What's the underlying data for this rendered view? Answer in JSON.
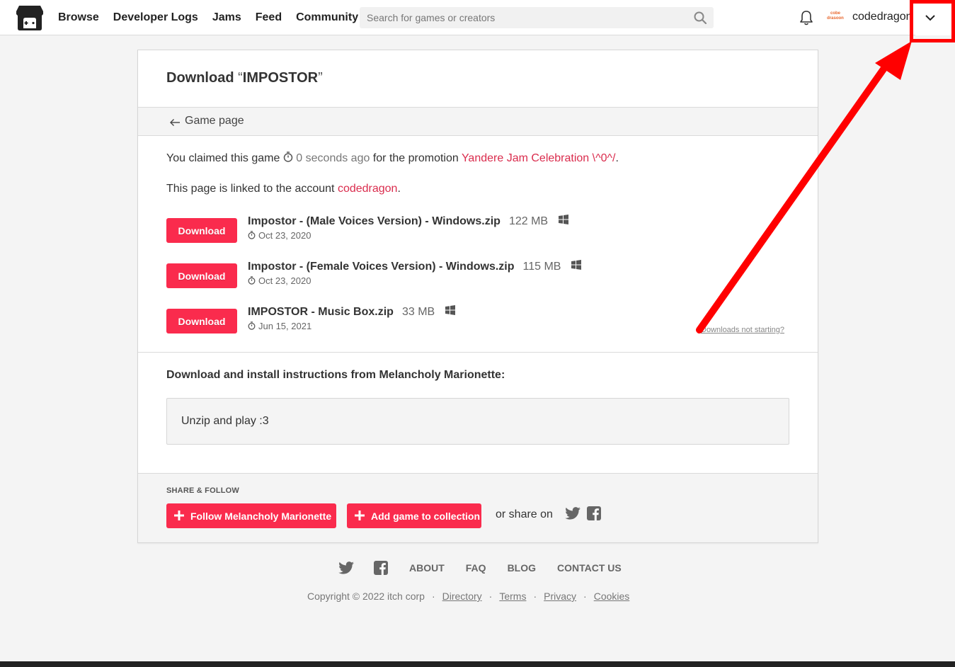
{
  "nav": {
    "items": [
      "Browse",
      "Developer Logs",
      "Jams",
      "Feed",
      "Community"
    ],
    "search_placeholder": "Search for games or creators",
    "username": "codedragon",
    "avatar_text": "cobe\ndrasoon"
  },
  "page": {
    "title_prefix": "Download ",
    "open_quote": "“",
    "game_name": "IMPOSTOR",
    "close_quote": "”",
    "game_page_link": "Game page",
    "claim_text": "You claimed this game",
    "claim_time": "0 seconds ago",
    "claim_for": "for the promotion",
    "promotion": "Yandere Jam Celebration \\^0^/",
    "claim_end": ".",
    "linked_text": "This page is linked to the account",
    "linked_account": "codedragon",
    "linked_end": "."
  },
  "downloads": [
    {
      "button": "Download",
      "name": "Impostor - (Male Voices Version) - Windows.zip",
      "size": "122 MB",
      "platform": "windows-icon",
      "date": "Oct 23, 2020"
    },
    {
      "button": "Download",
      "name": "Impostor - (Female Voices Version) - Windows.zip",
      "size": "115 MB",
      "platform": "windows-icon",
      "date": "Oct 23, 2020"
    },
    {
      "button": "Download",
      "name": "IMPOSTOR - Music Box.zip",
      "size": "33 MB",
      "platform": "windows-icon",
      "date": "Jun 15, 2021"
    }
  ],
  "downloads_not_starting": "Downloads not starting?",
  "instructions": {
    "title": "Download and install instructions from Melancholy Marionette:",
    "text": "Unzip and play :3"
  },
  "share": {
    "label": "SHARE & FOLLOW",
    "follow_button": "Follow Melancholy Marionette",
    "collection_button": "Add game to collection",
    "share_on": "or share on"
  },
  "footer": {
    "links": [
      "ABOUT",
      "FAQ",
      "BLOG",
      "CONTACT US"
    ],
    "copyright": "Copyright © 2022 itch corp",
    "legal": [
      "Directory",
      "Terms",
      "Privacy",
      "Cookies"
    ]
  },
  "colors": {
    "accent": "#fa2b4d",
    "link": "#da2c4d",
    "highlight": "#ff0000"
  }
}
